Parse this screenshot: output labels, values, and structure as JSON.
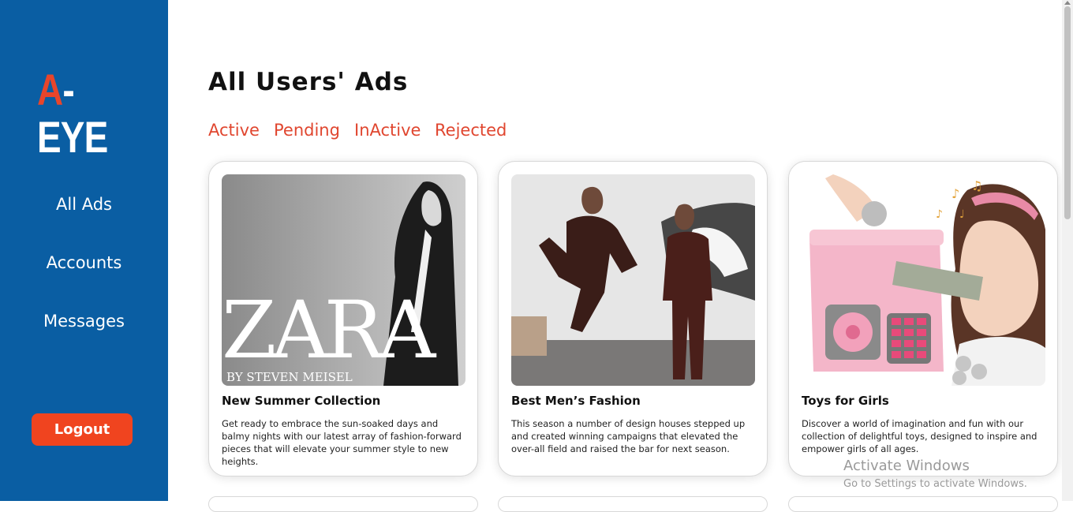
{
  "sidebar": {
    "logo_a": "A",
    "logo_rest": "-EYE",
    "nav": [
      "All Ads",
      "Accounts",
      "Messages"
    ],
    "logout_label": "Logout"
  },
  "main": {
    "title": "All Users' Ads",
    "tabs": [
      "Active",
      "Pending",
      "InActive",
      "Rejected"
    ],
    "cards": [
      {
        "title": "New Summer Collection",
        "description": "Get ready to embrace the sun-soaked days and balmy nights with our latest array of fashion-forward pieces that will elevate your summer style to new heights.",
        "image_text": "ZARA",
        "image_subtext": "BY STEVEN MEISEL"
      },
      {
        "title": "Best Men’s Fashion",
        "description": "This season a number of design houses stepped up and created winning campaigns that elevated the over-all field and raised the bar for next season."
      },
      {
        "title": "Toys for Girls",
        "description": "Discover a world of imagination and fun with our collection of delightful toys, designed to inspire and empower girls of all ages."
      }
    ]
  },
  "watermark": {
    "line1": "Activate Windows",
    "line2": "Go to Settings to activate Windows."
  },
  "colors": {
    "sidebar": "#0a5ea3",
    "accent": "#e0462f",
    "logout": "#f0441f"
  }
}
